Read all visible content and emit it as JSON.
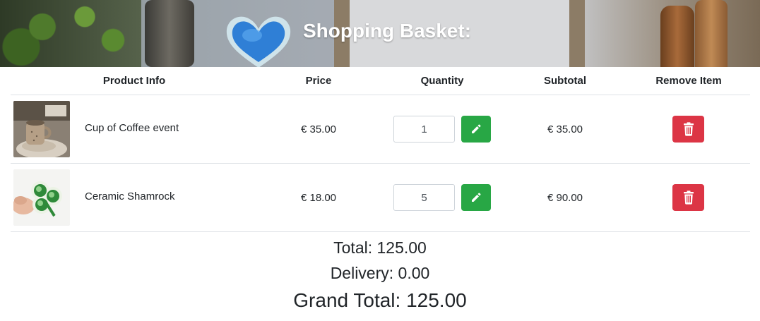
{
  "header": {
    "title": "Shopping Basket:"
  },
  "table": {
    "columns": {
      "product_info": "Product Info",
      "price": "Price",
      "quantity": "Quantity",
      "subtotal": "Subtotal",
      "remove": "Remove Item"
    },
    "rows": [
      {
        "name": "Cup of Coffee event",
        "price": "€ 35.00",
        "quantity": "1",
        "subtotal": "€ 35.00",
        "thumbnail": "coffee-cup-photo"
      },
      {
        "name": "Ceramic Shamrock",
        "price": "€ 18.00",
        "quantity": "5",
        "subtotal": "€ 90.00",
        "thumbnail": "ceramic-shamrock-photo"
      }
    ]
  },
  "summary": {
    "total": "Total: 125.00",
    "delivery": "Delivery: 0.00",
    "grand_total": "Grand Total: 125.00"
  },
  "icons": {
    "edit": "pencil-icon",
    "remove": "trash-icon"
  },
  "colors": {
    "update_button": "#28a745",
    "remove_button": "#dc3545",
    "divider": "#dee2e6",
    "title_text": "#ffffff"
  }
}
